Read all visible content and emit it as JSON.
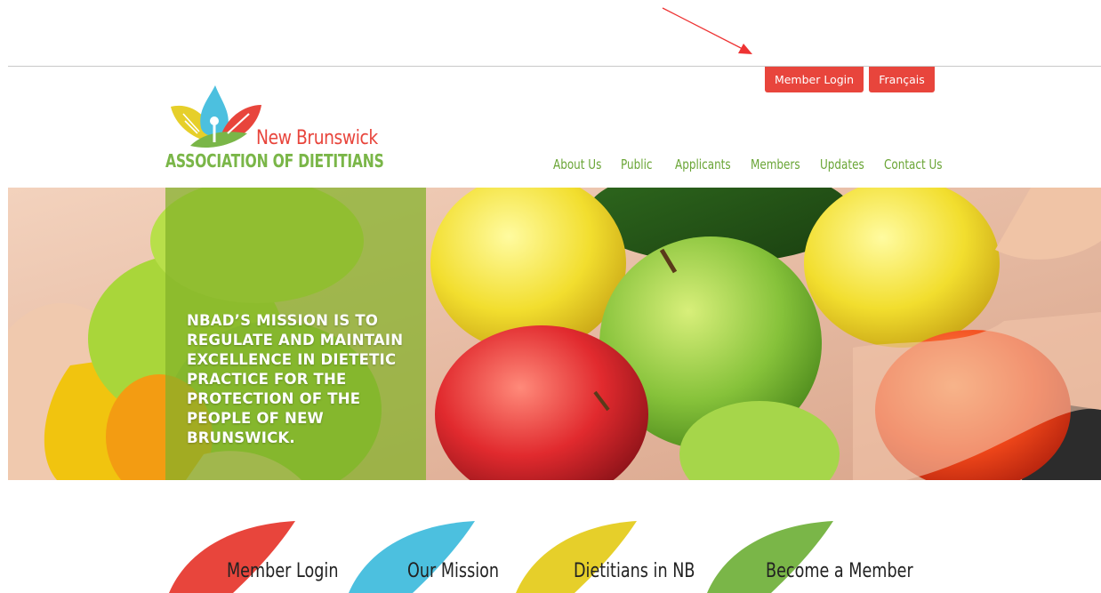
{
  "header": {
    "member_login": "Member Login",
    "francais": "Français",
    "logo_line1": "New Brunswick",
    "logo_line2": "ASSOCIATION OF DIETITIANS"
  },
  "nav": {
    "items": [
      "About Us",
      "Public",
      "Applicants",
      "Members",
      "Updates",
      "Contact Us"
    ]
  },
  "hero": {
    "mission": "NBAD’S MISSION IS TO REGULATE AND MAINTAIN EXCELLENCE IN DIETETIC PRACTICE FOR THE PROTECTION OF THE PEOPLE OF NEW BRUNSWICK."
  },
  "quick_links": [
    {
      "label": "Member Login",
      "color": "#e8453c"
    },
    {
      "label": "Our Mission",
      "color": "#4cc0df"
    },
    {
      "label": "Dietitians in NB",
      "color": "#e6cf2a"
    },
    {
      "label": "Become a Member",
      "color": "#7ab648"
    }
  ],
  "colors": {
    "accent_red": "#e8453c",
    "nav_green": "#6aa536"
  }
}
